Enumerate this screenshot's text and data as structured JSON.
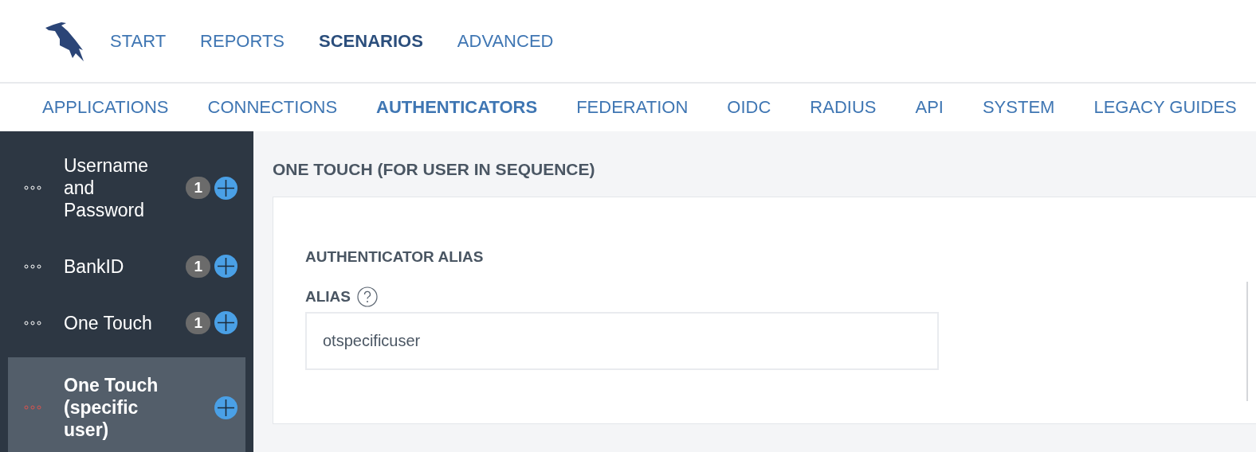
{
  "top_nav": [
    {
      "label": "START",
      "selected": false
    },
    {
      "label": "REPORTS",
      "selected": false
    },
    {
      "label": "SCENARIOS",
      "selected": true
    },
    {
      "label": "ADVANCED",
      "selected": false
    }
  ],
  "sub_nav": [
    {
      "label": "APPLICATIONS",
      "selected": false
    },
    {
      "label": "CONNECTIONS",
      "selected": false
    },
    {
      "label": "AUTHENTICATORS",
      "selected": true
    },
    {
      "label": "FEDERATION",
      "selected": false
    },
    {
      "label": "OIDC",
      "selected": false
    },
    {
      "label": "RADIUS",
      "selected": false
    },
    {
      "label": "API",
      "selected": false
    },
    {
      "label": "SYSTEM",
      "selected": false
    },
    {
      "label": "LEGACY GUIDES",
      "selected": false
    }
  ],
  "sidebar": {
    "items": [
      {
        "label": "Username and Password",
        "badge": "1",
        "selected": false
      },
      {
        "label": "BankID",
        "badge": "1",
        "selected": false
      },
      {
        "label": "One Touch",
        "badge": "1",
        "selected": false
      },
      {
        "label": "One Touch (specific user)",
        "selected": true
      }
    ]
  },
  "main": {
    "title": "ONE TOUCH (FOR USER IN SEQUENCE)",
    "section_title": "AUTHENTICATOR ALIAS",
    "field": {
      "label": "ALIAS",
      "value": "otspecificuser"
    }
  }
}
